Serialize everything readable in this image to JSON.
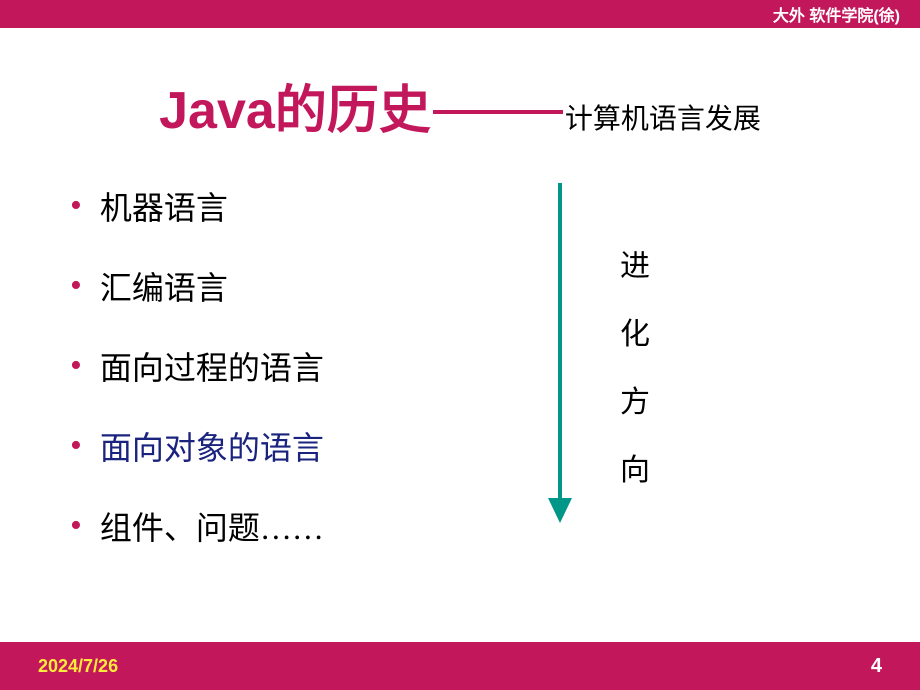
{
  "header": {
    "institution": "大外 软件学院(徐)"
  },
  "title": {
    "main": "Java的历史",
    "sub": "计算机语言发展"
  },
  "bullets": [
    {
      "text": "机器语言",
      "highlight": false
    },
    {
      "text": "汇编语言",
      "highlight": false
    },
    {
      "text": "面向过程的语言",
      "highlight": false
    },
    {
      "text": "面向对象的语言",
      "highlight": true
    },
    {
      "text": "组件、问题……",
      "highlight": false
    }
  ],
  "arrow_label": {
    "c1": "进",
    "c2": "化",
    "c3": "方",
    "c4": "向"
  },
  "footer": {
    "date": "2024/7/26",
    "page": "4"
  }
}
